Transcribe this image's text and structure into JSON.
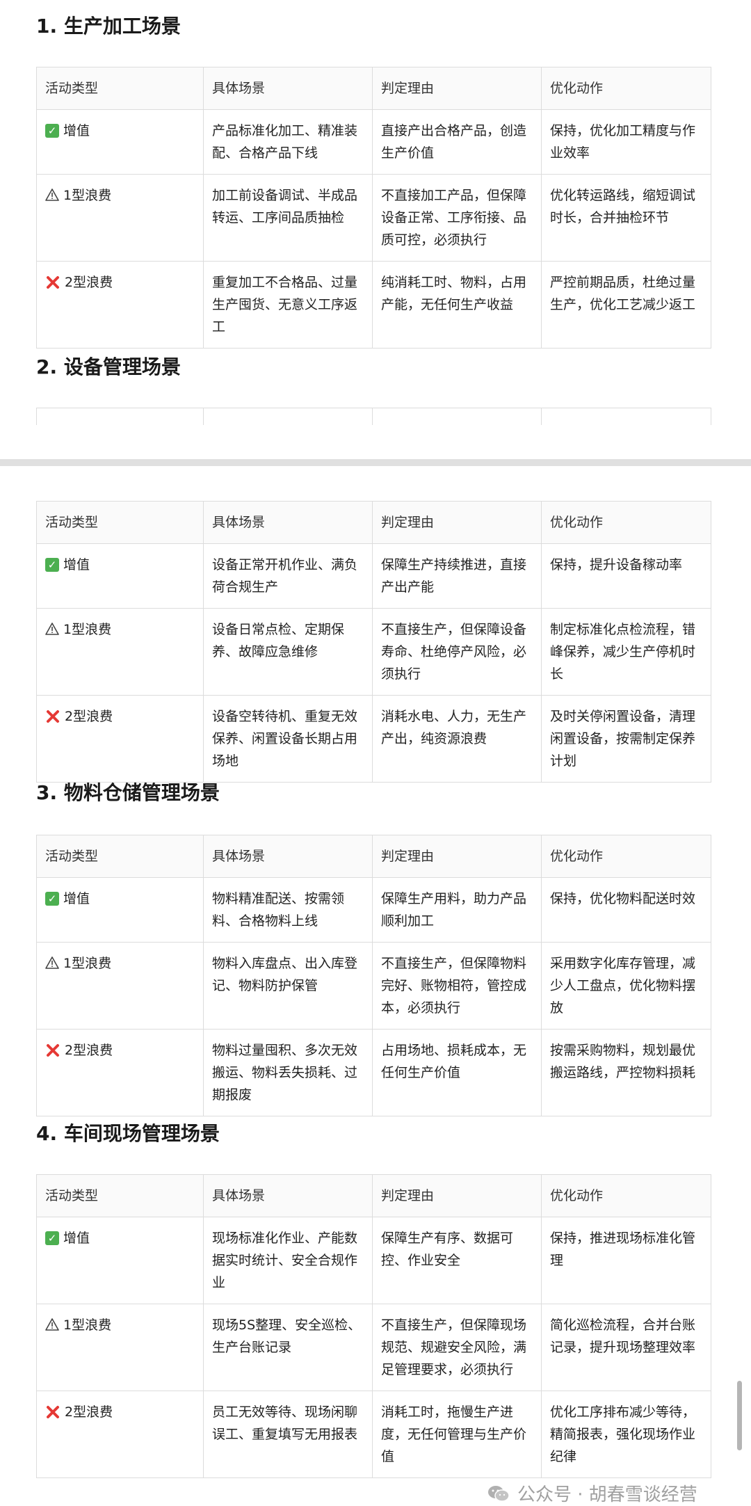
{
  "headers": [
    "活动类型",
    "具体场景",
    "判定理由",
    "优化动作"
  ],
  "sections": [
    {
      "title": "1. 生产加工场景",
      "rows": [
        {
          "type": "增值",
          "icon": "check",
          "scene": "产品标准化加工、精准装配、合格产品下线",
          "reason": "直接产出合格产品，创造生产价值",
          "action": "保持，优化加工精度与作业效率"
        },
        {
          "type": "1型浪费",
          "icon": "warning",
          "scene": "加工前设备调试、半成品转运、工序间品质抽检",
          "reason": "不直接加工产品，但保障设备正常、工序衔接、品质可控，必须执行",
          "action": "优化转运路线，缩短调试时长，合并抽检环节"
        },
        {
          "type": "2型浪费",
          "icon": "cross",
          "scene": "重复加工不合格品、过量生产囤货、无意义工序返工",
          "reason": "纯消耗工时、物料，占用产能，无任何生产收益",
          "action": "严控前期品质，杜绝过量生产，优化工艺减少返工"
        }
      ]
    },
    {
      "title": "2. 设备管理场景",
      "rows": [
        {
          "type": "增值",
          "icon": "check",
          "scene": "设备正常开机作业、满负荷合规生产",
          "reason": "保障生产持续推进，直接产出产能",
          "action": "保持，提升设备稼动率"
        },
        {
          "type": "1型浪费",
          "icon": "warning",
          "scene": "设备日常点检、定期保养、故障应急维修",
          "reason": "不直接生产，但保障设备寿命、杜绝停产风险，必须执行",
          "action": "制定标准化点检流程，错峰保养，减少生产停机时长"
        },
        {
          "type": "2型浪费",
          "icon": "cross",
          "scene": "设备空转待机、重复无效保养、闲置设备长期占用场地",
          "reason": "消耗水电、人力，无生产产出，纯资源浪费",
          "action": "及时关停闲置设备，清理闲置设备，按需制定保养计划"
        }
      ]
    },
    {
      "title": "3. 物料仓储管理场景",
      "rows": [
        {
          "type": "增值",
          "icon": "check",
          "scene": "物料精准配送、按需领料、合格物料上线",
          "reason": "保障生产用料，助力产品顺利加工",
          "action": "保持，优化物料配送时效"
        },
        {
          "type": "1型浪费",
          "icon": "warning",
          "scene": "物料入库盘点、出入库登记、物料防护保管",
          "reason": "不直接生产，但保障物料完好、账物相符，管控成本，必须执行",
          "action": "采用数字化库存管理，减少人工盘点，优化物料摆放"
        },
        {
          "type": "2型浪费",
          "icon": "cross",
          "scene": "物料过量囤积、多次无效搬运、物料丢失损耗、过期报废",
          "reason": "占用场地、损耗成本，无任何生产价值",
          "action": "按需采购物料，规划最优搬运路线，严控物料损耗"
        }
      ]
    },
    {
      "title": "4. 车间现场管理场景",
      "rows": [
        {
          "type": "增值",
          "icon": "check",
          "scene": "现场标准化作业、产能数据实时统计、安全合规作业",
          "reason": "保障生产有序、数据可控、作业安全",
          "action": "保持，推进现场标准化管理"
        },
        {
          "type": "1型浪费",
          "icon": "warning",
          "scene": "现场5S整理、安全巡检、生产台账记录",
          "reason": "不直接生产，但保障现场规范、规避安全风险，满足管理要求，必须执行",
          "action": "简化巡检流程，合并台账记录，提升现场整理效率"
        },
        {
          "type": "2型浪费",
          "icon": "cross",
          "scene": "员工无效等待、现场闲聊误工、重复填写无用报表",
          "reason": "消耗工时，拖慢生产进度，无任何管理与生产价值",
          "action": "优化工序排布减少等待，精简报表，强化现场作业纪律"
        }
      ]
    }
  ],
  "watermark": {
    "text": "公众号 · 胡春雪谈经营",
    "icon": "wechat-icon"
  },
  "colors": {
    "check": "#4caf50",
    "cross": "#e53935",
    "border": "#dcdcdc"
  }
}
